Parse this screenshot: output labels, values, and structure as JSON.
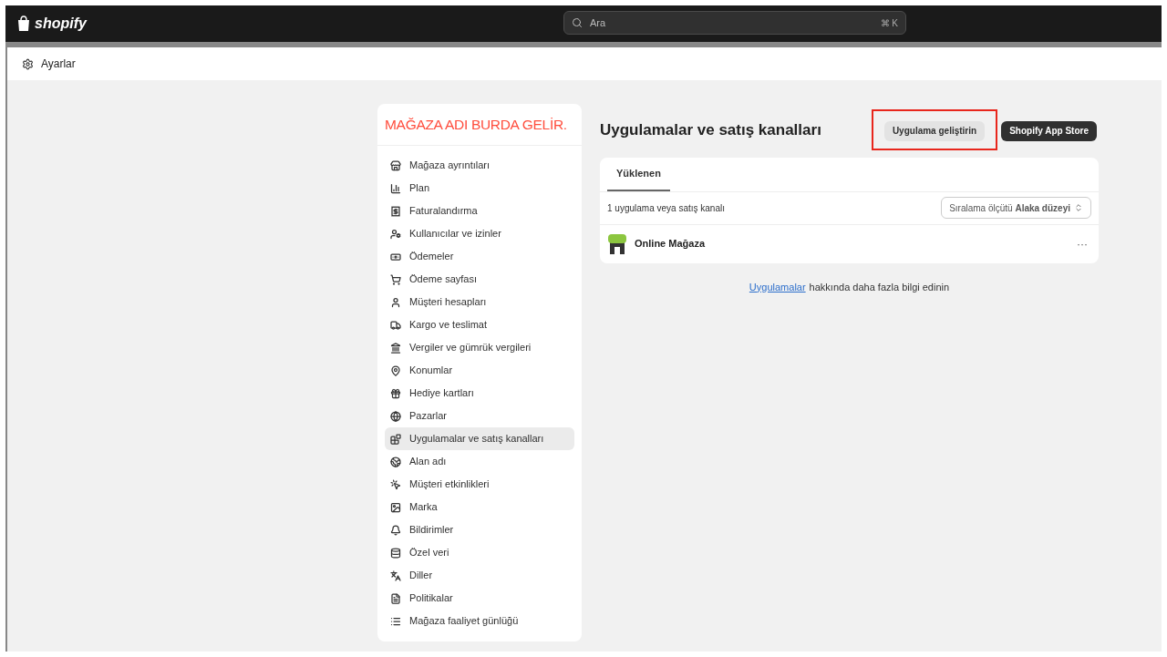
{
  "topbar": {
    "logo": "shopify",
    "search": {
      "placeholder": "Ara",
      "shortcut": "⌘ K"
    }
  },
  "header": {
    "title": "Ayarlar"
  },
  "sidebar": {
    "store_name": "MAĞAZA ADI BURDA GELİR.",
    "items": [
      {
        "label": "Mağaza ayrıntıları",
        "selected": false
      },
      {
        "label": "Plan",
        "selected": false
      },
      {
        "label": "Faturalandırma",
        "selected": false
      },
      {
        "label": "Kullanıcılar ve izinler",
        "selected": false
      },
      {
        "label": "Ödemeler",
        "selected": false
      },
      {
        "label": "Ödeme sayfası",
        "selected": false
      },
      {
        "label": "Müşteri hesapları",
        "selected": false
      },
      {
        "label": "Kargo ve teslimat",
        "selected": false
      },
      {
        "label": "Vergiler ve gümrük vergileri",
        "selected": false
      },
      {
        "label": "Konumlar",
        "selected": false
      },
      {
        "label": "Hediye kartları",
        "selected": false
      },
      {
        "label": "Pazarlar",
        "selected": false
      },
      {
        "label": "Uygulamalar ve satış kanalları",
        "selected": true
      },
      {
        "label": "Alan adı",
        "selected": false
      },
      {
        "label": "Müşteri etkinlikleri",
        "selected": false
      },
      {
        "label": "Marka",
        "selected": false
      },
      {
        "label": "Bildirimler",
        "selected": false
      },
      {
        "label": "Özel veri",
        "selected": false
      },
      {
        "label": "Diller",
        "selected": false
      },
      {
        "label": "Politikalar",
        "selected": false
      },
      {
        "label": "Mağaza faaliyet günlüğü",
        "selected": false
      }
    ]
  },
  "main": {
    "title": "Uygulamalar ve satış kanalları",
    "buttons": [
      {
        "label": "Uygulama geliştirin",
        "kind": "secondary",
        "highlighted": true
      },
      {
        "label": "Shopify App Store",
        "kind": "primary",
        "highlighted": false
      }
    ],
    "tabs": [
      {
        "label": "Yüklenen",
        "selected": true
      }
    ],
    "count": "1 uygulama veya satış kanalı",
    "sort": "Sıralama ölçütü **Alaka düzeyi**",
    "apps": [
      {
        "name": "Online Mağaza",
        "menu": "···"
      }
    ],
    "footer": {
      "link": "Uygulamalar",
      "text": "hakkında daha fazla bilgi edinin"
    }
  }
}
